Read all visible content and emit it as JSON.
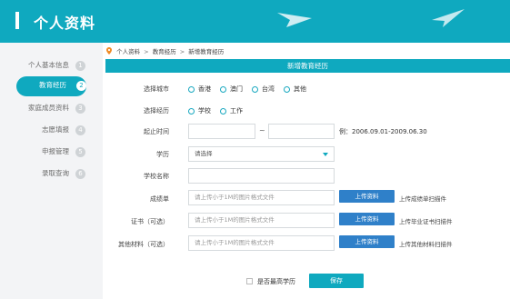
{
  "header": {
    "title": "个人资料"
  },
  "sidebar": {
    "items": [
      {
        "label": "个人基本信息",
        "num": "1"
      },
      {
        "label": "教育经历",
        "num": "2"
      },
      {
        "label": "家庭成员资料",
        "num": "3"
      },
      {
        "label": "志愿填报",
        "num": "4"
      },
      {
        "label": "申报管理",
        "num": "5"
      },
      {
        "label": "录取查询",
        "num": "6"
      }
    ]
  },
  "breadcrumb": {
    "items": [
      "个人资料",
      "教育经历",
      "新增教育经历"
    ],
    "separator": ">"
  },
  "section": {
    "title": "新增教育经历"
  },
  "form": {
    "city": {
      "label": "选择城市",
      "options": [
        "香港",
        "澳门",
        "台湾",
        "其他"
      ]
    },
    "experience": {
      "label": "选择经历",
      "options": [
        "学校",
        "工作"
      ]
    },
    "period": {
      "label": "起止时间",
      "tilde": "~",
      "example": "例：2006.09.01-2009.06.30"
    },
    "education": {
      "label": "学历",
      "placeholder": "请选择"
    },
    "school": {
      "label": "学校名称"
    },
    "transcript": {
      "label": "成绩单",
      "placeholder": "请上传小于1M的图片格式文件",
      "button": "上传资料",
      "hint": "上传成绩单扫描件"
    },
    "certificate": {
      "label": "证书（可选）",
      "placeholder": "请上传小于1M的图片格式文件",
      "button": "上传资料",
      "hint": "上传毕业证书扫描件"
    },
    "other": {
      "label": "其他材料（可选）",
      "placeholder": "请上传小于1M的图片格式文件",
      "button": "上传资料",
      "hint": "上传其他材料扫描件"
    },
    "highest": {
      "label": "是否最高学历"
    },
    "save": "保存"
  },
  "colors": {
    "accent": "#0fa9bf",
    "upload": "#2f80c9"
  }
}
